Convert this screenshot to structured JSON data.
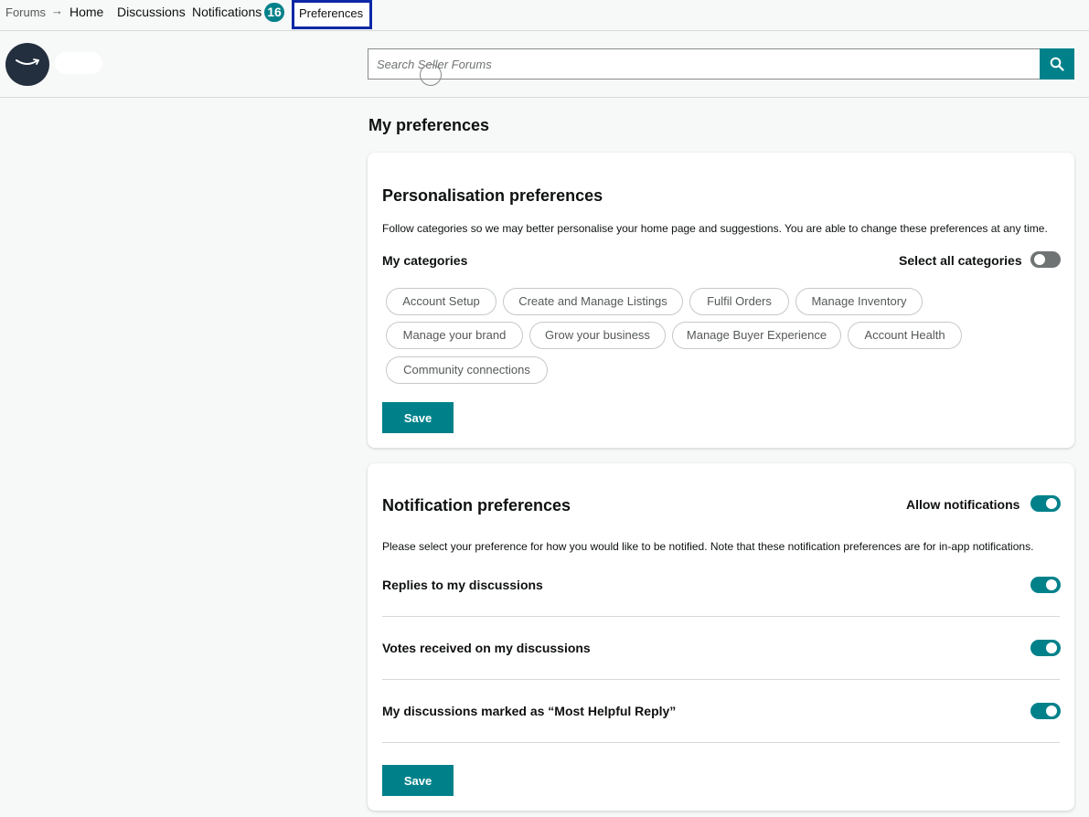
{
  "topnav": {
    "forums": "Forums",
    "home": "Home",
    "discussions": "Discussions",
    "notifications": "Notifications",
    "notifications_count": "16",
    "preferences": "Preferences"
  },
  "search": {
    "placeholder": "Search Seller Forums"
  },
  "page_title": "My preferences",
  "personalisation": {
    "title": "Personalisation preferences",
    "description": "Follow categories so we may better personalise your home page and suggestions. You are able to change these preferences at any time.",
    "my_categories_label": "My categories",
    "select_all_label": "Select all categories",
    "select_all_on": false,
    "categories": [
      "Account Setup",
      "Create and Manage Listings",
      "Fulfil Orders",
      "Manage Inventory",
      "Manage your brand",
      "Grow your business",
      "Manage Buyer Experience",
      "Account Health",
      "Community connections"
    ],
    "save_label": "Save"
  },
  "notification": {
    "title": "Notification preferences",
    "allow_label": "Allow notifications",
    "allow_on": true,
    "description": "Please select your preference for how you would like to be notified. Note that these notification preferences are for in-app notifications.",
    "items": [
      {
        "label": "Replies to my discussions",
        "on": true
      },
      {
        "label": "Votes received on my discussions",
        "on": true
      },
      {
        "label": "My discussions marked as “Most Helpful Reply”",
        "on": true
      }
    ],
    "save_label": "Save"
  },
  "colors": {
    "accent": "#00818a",
    "toggle_off": "#6f7373",
    "highlight_border": "#0d28a6",
    "header_bg": "#232f3e"
  }
}
